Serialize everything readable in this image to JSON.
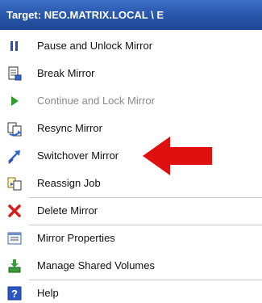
{
  "header": {
    "title": "Target: NEO.MATRIX.LOCAL \\ E"
  },
  "menu": {
    "items": [
      {
        "label": "Pause and Unlock Mirror",
        "icon": "pause-icon",
        "enabled": true
      },
      {
        "label": "Break Mirror",
        "icon": "break-document-icon",
        "enabled": true
      },
      {
        "label": "Continue and Lock Mirror",
        "icon": "play-icon",
        "enabled": false
      },
      {
        "label": "Resync Mirror",
        "icon": "resync-icon",
        "enabled": true
      },
      {
        "label": "Switchover Mirror",
        "icon": "switchover-icon",
        "enabled": true
      },
      {
        "label": "Reassign Job",
        "icon": "reassign-icon",
        "enabled": true
      },
      {
        "label": "Delete Mirror",
        "icon": "red-x-icon",
        "enabled": true
      },
      {
        "label": "Mirror Properties",
        "icon": "properties-icon",
        "enabled": true
      },
      {
        "label": "Manage Shared Volumes",
        "icon": "shared-volumes-icon",
        "enabled": true
      },
      {
        "label": "Help",
        "icon": "help-icon",
        "enabled": true
      }
    ]
  },
  "colors": {
    "header_bg": "#2755a8",
    "annotation_arrow": "#e01010",
    "disabled_text": "#8a8a8a"
  }
}
